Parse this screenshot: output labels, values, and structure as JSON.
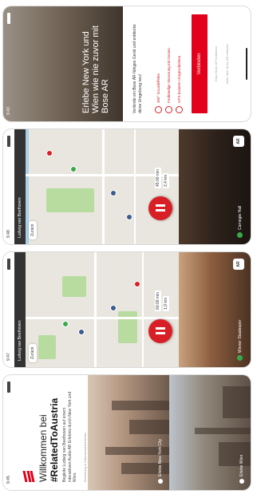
{
  "status": {
    "time1": "9:45",
    "time2": "9:47",
    "time3": "9:48",
    "time4": "9:43"
  },
  "welcome": {
    "title": "Willkommen bei",
    "hashtag": "#RelatedToAustria",
    "text": "Begleite Ludwig van Beethoven auf einem interaktiven Audio AR Erlebnis durch New York und Wien.",
    "link": "Bewertung & Datenschutzhinweise",
    "city1": "Erlebe New York City",
    "city2": "Erlebe Wien"
  },
  "map_vienna": {
    "bar": "Ludwig van Beethoven",
    "back": "Zurück",
    "info": "60:00 min",
    "info2": "1,9 km",
    "photo_label": "Wiener Staatsoper",
    "ar": "AR"
  },
  "map_nyc": {
    "bar": "Ludwig van Beethoven",
    "back": "Zurück",
    "info": "45:00 min",
    "info2": "2,4 km",
    "photo_label": "Carnegie Hall",
    "ar": "AR"
  },
  "promo": {
    "title": "Erlebe New York und Wien wie nie zuvor mit Bose AR",
    "body": "Verbinde ein Bose AR-fähiges Gerät und entdecke deine Umgebung neu!",
    "features": [
      "360° Soundeffekte",
      "Freihändige Steuerung mit Gesten",
      "GPS basierte Hörgeschichten"
    ],
    "cta": "Verbinden",
    "alt1": "Ohne Bose AR fortfahren",
    "alt2": "Mehr über Bose AR erfahren"
  }
}
